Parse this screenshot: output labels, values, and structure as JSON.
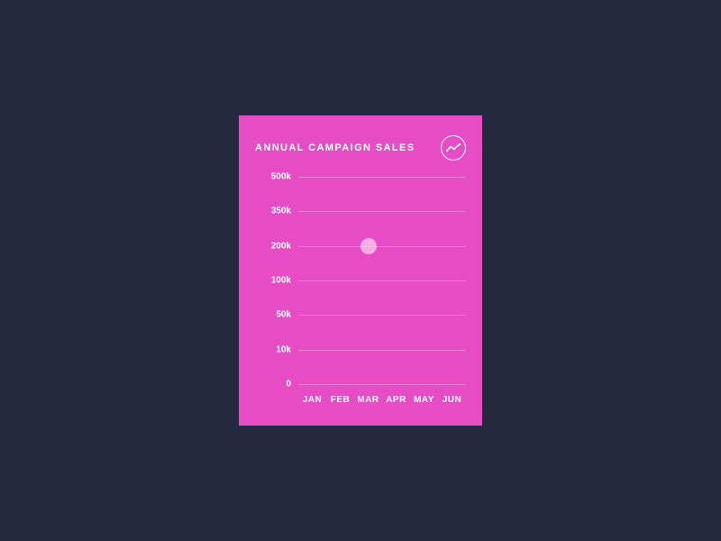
{
  "card": {
    "title": "ANNUAL CAMPAIGN SALES"
  },
  "chart_data": {
    "type": "line",
    "title": "Annual Campaign Sales",
    "xlabel": "",
    "ylabel": "",
    "categories": [
      "JAN",
      "FEB",
      "MAR",
      "APR",
      "MAY",
      "JUN"
    ],
    "y_ticks": [
      0,
      10000,
      50000,
      100000,
      200000,
      350000,
      500000
    ],
    "y_tick_labels": [
      "0",
      "10k",
      "50k",
      "100k",
      "200k",
      "350k",
      "500k"
    ],
    "ylim": [
      0,
      500000
    ],
    "series": [
      {
        "name": "Sales",
        "values": [
          null,
          null,
          200000,
          null,
          null,
          null
        ]
      }
    ],
    "highlight": {
      "category": "MAR",
      "value": 200000
    }
  }
}
